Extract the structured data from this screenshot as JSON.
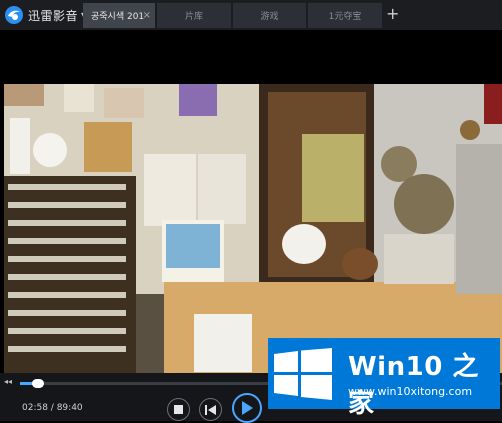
{
  "app": {
    "name": "迅雷影音",
    "logo_icon": "thunder-player-logo-icon"
  },
  "tabs": [
    {
      "label": "공죽시색 201",
      "active": true
    },
    {
      "label": "片库",
      "active": false
    },
    {
      "label": "游戏",
      "active": false
    },
    {
      "label": "1元夺宝",
      "active": false
    }
  ],
  "icons": {
    "add_tab": "+",
    "close": "×",
    "rewind": "◂◂"
  },
  "player": {
    "current_time": "02:58",
    "separator": " / ",
    "total_time": "89:40",
    "progress": 0.033,
    "accent_color": "#4aa7ff"
  },
  "watermark": {
    "title": "Win10 之家",
    "url": "www.win10xitong.com",
    "color": "#0078d7"
  }
}
